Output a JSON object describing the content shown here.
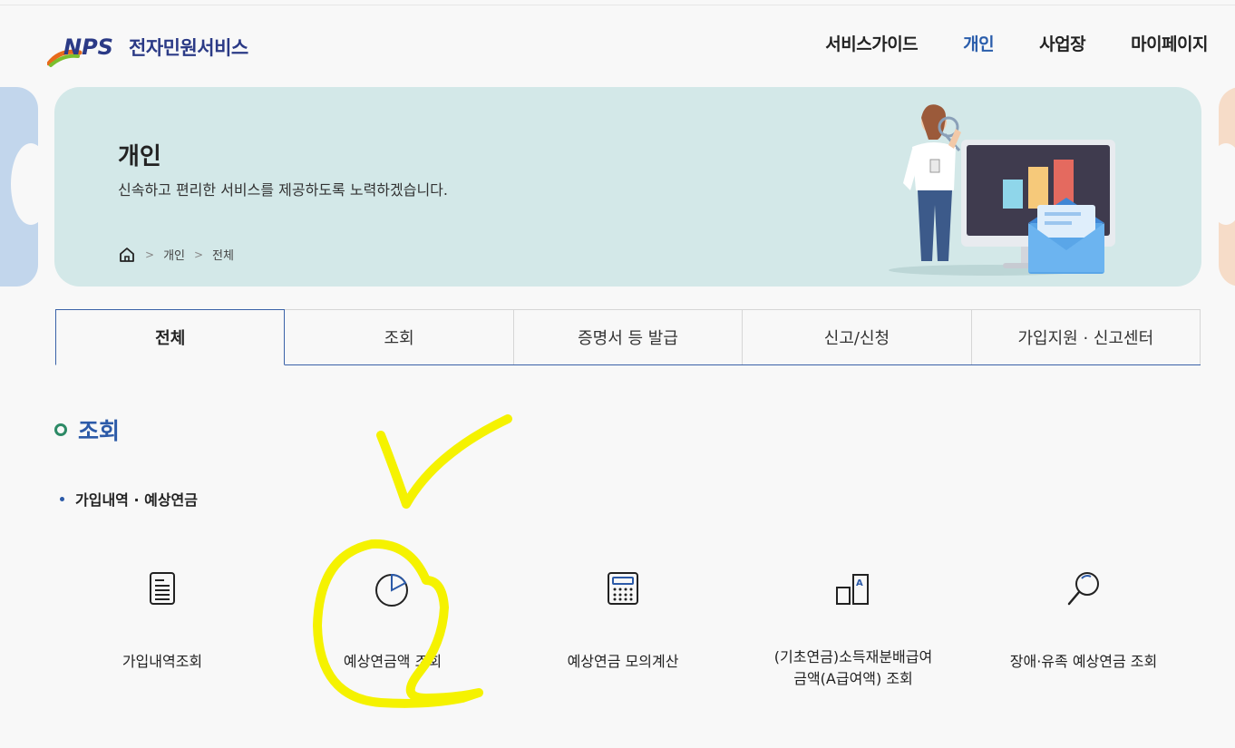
{
  "header": {
    "logo_abbr": "NPS",
    "logo_text": "전자민원서비스",
    "nav": [
      "서비스가이드",
      "개인",
      "사업장",
      "마이페이지"
    ]
  },
  "banner": {
    "title": "개인",
    "subtitle": "신속하고 편리한 서비스를 제공하도록 노력하겠습니다.",
    "breadcrumb": [
      "개인",
      "전체"
    ]
  },
  "tabs": [
    "전체",
    "조회",
    "증명서 등 발급",
    "신고/신청",
    "가입지원 · 신고센터"
  ],
  "section": {
    "title": "조회",
    "subtitle": "가입내역 · 예상연금",
    "items": [
      {
        "label": "가입내역조회",
        "icon": "document-icon"
      },
      {
        "label": "예상연금액 조회",
        "icon": "pie-chart-icon"
      },
      {
        "label": "예상연금 모의계산",
        "icon": "calculator-icon"
      },
      {
        "label_line1": "(기초연금)소득재분배급여",
        "label_line2": "금액(A급여액) 조회",
        "icon": "a-value-icon"
      },
      {
        "label": "장애·유족 예상연금 조회",
        "icon": "magnifier-icon"
      }
    ]
  },
  "colors": {
    "accent": "#2a5dab",
    "banner_bg": "#d3e8e8",
    "highlight": "#f5f200"
  }
}
